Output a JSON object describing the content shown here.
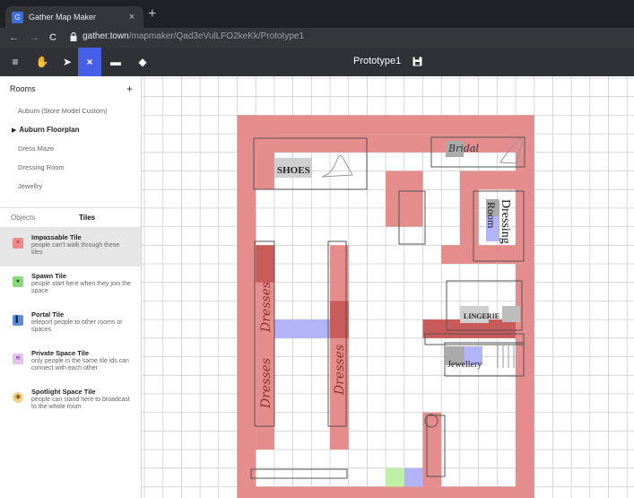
{
  "browser": {
    "tab_title": "Gather Map Maker",
    "tab_close": "×",
    "new_tab": "+",
    "url_domain": "gather.town",
    "url_path": "/mapmaker/Qad3eVulLFO2keKk/Prototype1",
    "back": "←",
    "forward": "→",
    "reload": "C"
  },
  "toolbar": {
    "title": "Prototype1",
    "tools": [
      {
        "icon": "menu-icon",
        "glyph": "≡"
      },
      {
        "icon": "hand-icon",
        "glyph": "✋"
      },
      {
        "icon": "pointer-icon",
        "glyph": "➤"
      },
      {
        "icon": "impassable-tool-icon",
        "glyph": "×"
      },
      {
        "icon": "object-tool-icon",
        "glyph": "▬"
      },
      {
        "icon": "eraser-icon",
        "glyph": "◆"
      }
    ],
    "accent_color": "#4560e6"
  },
  "sidebar": {
    "rooms_label": "Rooms",
    "add_label": "+",
    "rooms": [
      {
        "label": "Auburn (Store Model Custom)",
        "kind": "item"
      },
      {
        "label": "Auburn Floorplan",
        "kind": "parent"
      },
      {
        "label": "Dress Maze",
        "kind": "item"
      },
      {
        "label": "Dressing Room",
        "kind": "item"
      },
      {
        "label": "Jewellry",
        "kind": "item"
      }
    ],
    "tab_objects": "Objects",
    "tab_tiles": "Tiles",
    "tiles": [
      {
        "name": "Impassable Tile",
        "desc": "people can't walk through these tiles",
        "icon": "impassable-icon",
        "glyph": "×",
        "color": "#f08a8a"
      },
      {
        "name": "Spawn Tile",
        "desc": "people start here when they join the space",
        "icon": "spawn-icon",
        "glyph": "●",
        "color": "#8cd87c"
      },
      {
        "name": "Portal Tile",
        "desc": "teleport people to other rooms or spaces",
        "icon": "portal-icon",
        "glyph": "▌",
        "color": "#5e8fd6"
      },
      {
        "name": "Private Space Tile",
        "desc": "only people in the same tile ids can connect with each other",
        "icon": "private-space-icon",
        "glyph": "≋",
        "color": "#d6a6e8"
      },
      {
        "name": "Spotlight Space Tile",
        "desc": "people can stand here to broadcast to the whole room",
        "icon": "spotlight-icon",
        "glyph": "◉",
        "color": "#f4d28a"
      }
    ]
  },
  "map": {
    "labels": {
      "shoes": "SHOES",
      "bridal": "Bridal",
      "dressing": "Dressing",
      "room": "Room",
      "lingerie": "LINGERIE",
      "jewellery": "Jewellery",
      "dresses": "Dresses"
    },
    "colors": {
      "impassable": "#e58c8c",
      "impassable_dark": "#c95a5a",
      "portal": "#b3b3f7",
      "spawn": "#bff0a8",
      "grid": "#cfcfcf"
    }
  }
}
